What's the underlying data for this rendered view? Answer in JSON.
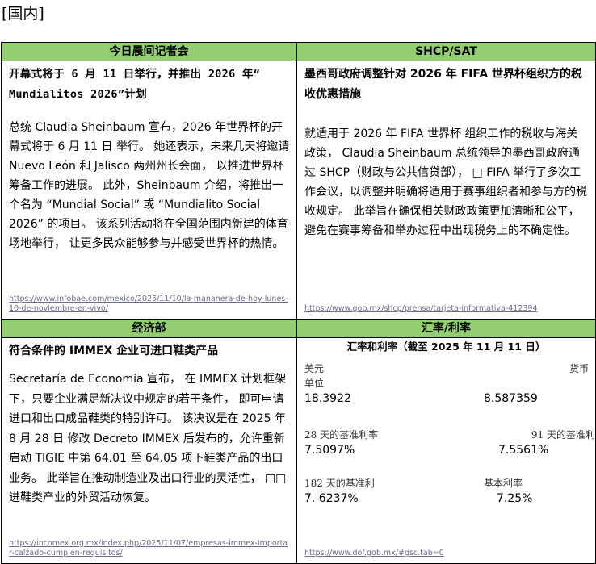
{
  "page_heading": "[国内]",
  "sections": {
    "press": {
      "header": "今日晨间记者会",
      "title_line1": "开幕式将于 6 月 11 日举行，并推出 2026 年“",
      "title_line2": "Mundialitos 2026”计划",
      "body": "总统 Claudia Sheinbaum 宣布，2026 年世界杯的开幕式将于 6 月 11 日 举行。 她还表示，未来几天将邀请 Nuevo León 和 Jalisco 两州州长会面， 以推进世界杯筹备工作的进展。 此外，Sheinbaum 介绍，将推出一个名为 “Mundial Social” 或 “Mundialito Social 2026” 的项目。 该系列活动将在全国范围内新建的体育场地举行， 让更多民众能够参与并感受世界杯的热情。",
      "link": "https://www.infobae.com/mexico/2025/11/10/la-mananera-de-hoy-lunes-10-de-noviembre-en-vivo/"
    },
    "shcp": {
      "header": "SHCP/SAT",
      "title": "墨西哥政府调整针对 2026 年 FIFA 世界杯组织方的税收优惠措施",
      "body": "就适用于 2026 年 FIFA 世界杯 组织工作的税收与海关政策， Claudia Sheinbaum 总统领导的墨西哥政府通过 SHCP（财政与公共信贷部）， □ FIFA 举行了多次工作会议，以调整并明确将适用于赛事组织者和参与方的税收规定。 此举旨在确保相关财政政策更加清晰和公平， 避免在赛事筹备和举办过程中出现税务上的不确定性。",
      "link": "https://www.gob.mx/shcp/prensa/tarjeta-informativa-412394"
    },
    "economy": {
      "header": "经济部",
      "title": "符合条件的 IMMEX 企业可进口鞋类产品",
      "body": "Secretaría de Economía 宣布， 在 IMMEX 计划框架下，只要企业满足新决议中规定的若干条件， 即可申请进口和出口成品鞋类的特别许可。 该决议是在 2025 年 8 月 28 日 修改 Decreto IMMEX 后发布的，允许重新启动 TIGIE 中第 64.01 至 64.05 项下鞋类产品的出口业务。 此举旨在推动制造业及出口行业的灵活性， □□进鞋类产业的外贸活动恢复。",
      "link": "https://incomex.org.mx/index.php/2025/11/07/empresas-immex-importar-calzado-cumplen-requisitos/"
    },
    "rates": {
      "header": "汇率/利率",
      "title": "汇率和利率（截至 2025 年 11 月 11 日）",
      "usd_label_1": "美元",
      "usd_label_2": "单位",
      "usd_value": "18.3922",
      "udi_label": "货币",
      "udi_value": "8.587359",
      "t28_label": "28 天的基准利率",
      "t28_value": "7.5097%",
      "t91_label": "91 天的基准利率",
      "t91_value": "7.5561%",
      "t182_label": "182 天的基准利",
      "t182_value": "7. 6237%",
      "base_label": "基本利率",
      "base_value": "7.25%",
      "link": "https://www.dof.gob.mx/#gsc.tab=0"
    }
  },
  "colors": {
    "header_bg": "#93cf72",
    "link": "#6b6b8e"
  }
}
